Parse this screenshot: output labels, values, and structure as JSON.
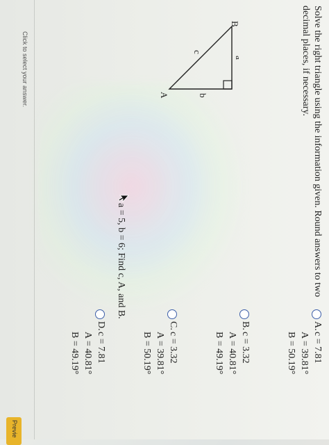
{
  "question": {
    "instruction": "Solve the right triangle using the information given. Round answers to two decimal places, if necessary.",
    "given": "a = 5, b = 6;  Find c, A, and B."
  },
  "figure": {
    "vertex_a": "A",
    "vertex_b": "B",
    "side_a": "a",
    "side_b": "b",
    "side_c": "c"
  },
  "choices": [
    {
      "letter": "A.",
      "line1": "c = 7.81",
      "line2": "A = 39.81°",
      "line3": "B = 50.19°"
    },
    {
      "letter": "B.",
      "line1": "c = 3.32",
      "line2": "A = 40.81°",
      "line3": "B = 49.19°"
    },
    {
      "letter": "C.",
      "line1": "c = 3.32",
      "line2": "A = 39.81°",
      "line3": "B = 50.19°"
    },
    {
      "letter": "D.",
      "line1": "c = 7.81",
      "line2": "A = 40.81°",
      "line3": "B = 49.19°"
    }
  ],
  "footer": {
    "hint": "Click to select your answer.",
    "preview_button": "Previe"
  },
  "colors": {
    "radio_border": "#3b5da8",
    "preview_button": "#e8b42a"
  }
}
